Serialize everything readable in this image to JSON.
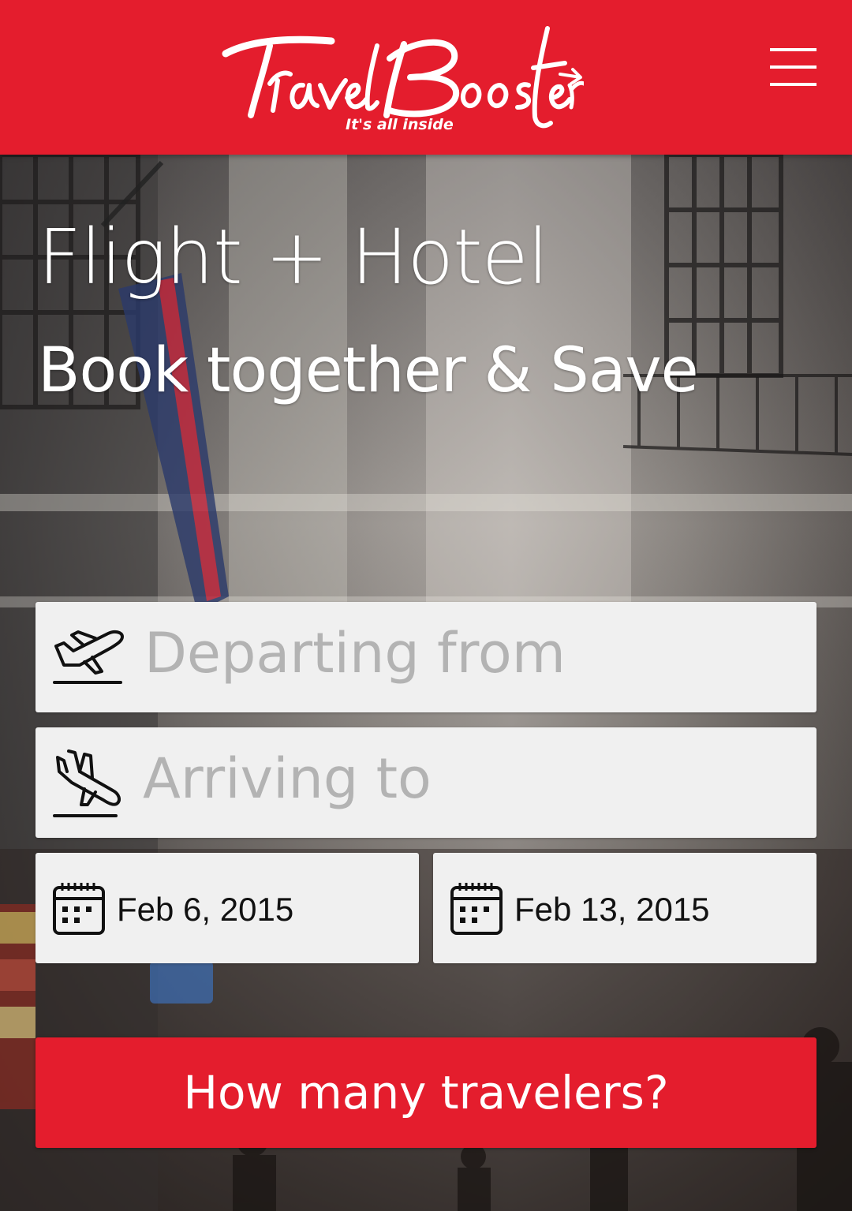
{
  "header": {
    "logo_text": "TravelBooster",
    "logo_tagline": "It's all inside",
    "menu_icon": "hamburger-menu-icon",
    "background_color": "#e41d2d"
  },
  "hero": {
    "title": "Flight + Hotel",
    "subtitle": "Book together & Save"
  },
  "search_form": {
    "departing": {
      "placeholder": "Departing from",
      "icon": "plane-takeoff-icon"
    },
    "arriving": {
      "placeholder": "Arriving to",
      "icon": "plane-landing-icon"
    },
    "depart_date": {
      "value": "Feb 6, 2015",
      "icon": "calendar-icon"
    },
    "return_date": {
      "value": "Feb 13, 2015",
      "icon": "calendar-icon"
    },
    "travelers_button": "How many travelers?"
  },
  "colors": {
    "brand_red": "#e41d2d",
    "field_background": "#f0f0f0",
    "placeholder_text": "#b3b3b3"
  }
}
